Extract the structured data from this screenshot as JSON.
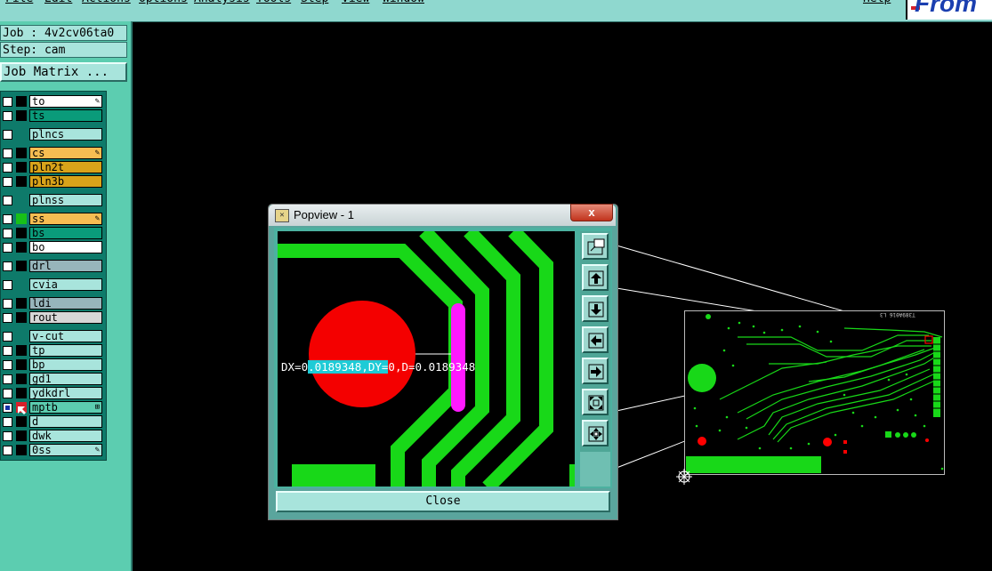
{
  "menu": [
    "File",
    "Edit",
    "Actions",
    "Options",
    "Analysis",
    "Tools",
    "Step",
    "View",
    "Window",
    "Help"
  ],
  "logo_text": "From",
  "job": {
    "job_line": "Job : 4v2cv06ta0",
    "step_line": "Step: cam"
  },
  "job_matrix_label": "Job Matrix ...",
  "layers": [
    {
      "name": "to",
      "color": "#ffffff",
      "mark": "#000000",
      "checked": false,
      "editable": true
    },
    {
      "name": "ts",
      "color": "#0a9b7a",
      "mark": "#000000",
      "checked": false,
      "editable": false
    },
    {
      "name": "plncs",
      "color": "#a8e4dc",
      "mark": "#0e7a6a",
      "checked": false,
      "editable": false
    },
    {
      "name": "cs",
      "color": "#f6bd52",
      "mark": "#000000",
      "checked": false,
      "editable": true
    },
    {
      "name": "pln2t",
      "color": "#d8a31a",
      "mark": "#000000",
      "checked": false,
      "editable": false
    },
    {
      "name": "pln3b",
      "color": "#d8a31a",
      "mark": "#000000",
      "checked": false,
      "editable": false
    },
    {
      "name": "plnss",
      "color": "#a8e4dc",
      "mark": "#0e7a6a",
      "checked": false,
      "editable": false
    },
    {
      "name": "ss",
      "color": "#f6bd52",
      "mark": "#18c018",
      "checked": false,
      "editable": true
    },
    {
      "name": "bs",
      "color": "#0a9b7a",
      "mark": "#000000",
      "checked": false,
      "editable": false
    },
    {
      "name": "bo",
      "color": "#ffffff",
      "mark": "#000000",
      "checked": false,
      "editable": false
    },
    {
      "name": "drl",
      "color": "#97b5bb",
      "mark": "#000000",
      "checked": false,
      "editable": false
    },
    {
      "name": "cvia",
      "color": "#a8e4dc",
      "mark": "#0e7a6a",
      "checked": false,
      "editable": false
    },
    {
      "name": "ldi",
      "color": "#97b5bb",
      "mark": "#000000",
      "checked": false,
      "editable": false
    },
    {
      "name": "rout",
      "color": "#d7d7d7",
      "mark": "#000000",
      "checked": false,
      "editable": false
    },
    {
      "name": "v-cut",
      "color": "#a8e4dc",
      "mark": "#0e7a6a",
      "checked": false,
      "editable": false
    },
    {
      "name": "tp",
      "color": "#a8e4dc",
      "mark": "#000000",
      "checked": false,
      "editable": false
    },
    {
      "name": "bp",
      "color": "#a8e4dc",
      "mark": "#000000",
      "checked": false,
      "editable": false
    },
    {
      "name": "gd1",
      "color": "#a8e4dc",
      "mark": "#000000",
      "checked": false,
      "editable": false
    },
    {
      "name": "ydkdrl",
      "color": "#a8e4dc",
      "mark": "#000000",
      "checked": false,
      "editable": false
    },
    {
      "name": "mptb",
      "color": "#5ccdb0",
      "mark": "#d8202a",
      "checked": true,
      "editable": false,
      "extra": "⊞"
    },
    {
      "name": "d",
      "color": "#a8e4dc",
      "mark": "#000000",
      "checked": false,
      "editable": false
    },
    {
      "name": "dwk",
      "color": "#a8e4dc",
      "mark": "#000000",
      "checked": false,
      "editable": false
    },
    {
      "name": "0ss",
      "color": "#a8e4dc",
      "mark": "#000000",
      "checked": false,
      "editable": true
    }
  ],
  "popview": {
    "title": "Popview - 1",
    "close_x": "x",
    "close_label": "Close",
    "measurement": {
      "before": "DX=0",
      "highlight": ".0189348,DY=",
      "after": "0,D=0.0189348"
    }
  },
  "board": {
    "silk_text": "T389A016 L3"
  },
  "colors": {
    "menubar": "#8fd8cf",
    "panel": "#5ccdb0",
    "trace": "#18d818",
    "pad": "#f00000",
    "measure": "#ff19ff"
  }
}
